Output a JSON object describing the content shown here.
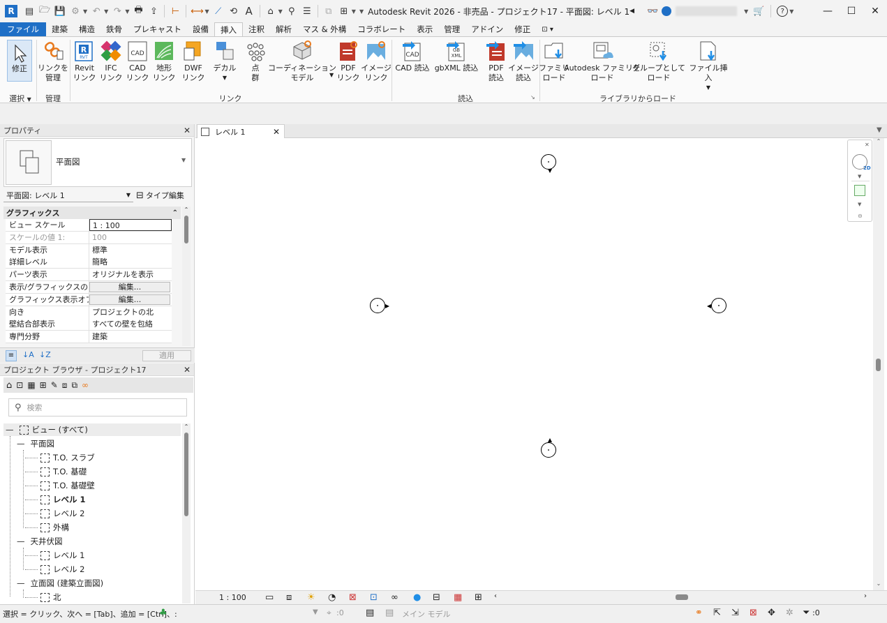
{
  "app": {
    "logo": "R",
    "title": "Autodesk Revit 2026 - 非売品 - プロジェクト17 - 平面図: レベル 1"
  },
  "tabs": [
    "ファイル",
    "建築",
    "構造",
    "鉄骨",
    "プレキャスト",
    "設備",
    "挿入",
    "注釈",
    "解析",
    "マス & 外構",
    "コラボレート",
    "表示",
    "管理",
    "アドイン",
    "修正"
  ],
  "active_tab": "挿入",
  "ribbon": {
    "modify": "修正",
    "manage_links": "リンクを\n管理",
    "revit_link": "Revit\nリンク",
    "ifc_link": "IFC\nリンク",
    "cad_link": "CAD\nリンク",
    "topo_link": "地形\nリンク",
    "dwf_link": "DWF\nリンク",
    "decal": "デカル",
    "point_cloud": "点\n群",
    "coord_model": "コーディネーション\nモデル",
    "pdf_link": "PDF\nリンク",
    "image_link": "イメージ\nリンク",
    "cad_import": "CAD 読込",
    "gbxml_import": "gbXML 読込",
    "pdf_import": "PDF\n読込",
    "image_import": "イメージ\n読込",
    "load_family": "ファミリ\nロード",
    "autodesk_family": "Autodesk ファミリを\nロード",
    "load_group": "グループとして\nロード",
    "insert_file": "ファイル挿入",
    "panel_select": "選択",
    "panel_manage": "管理",
    "panel_link": "リンク",
    "panel_import": "読込",
    "panel_library": "ライブラリからロード",
    "icon_labels": {
      "cad": "CAD",
      "gbxml": "GB\nXML",
      "rvt": "RVT"
    }
  },
  "properties": {
    "title": "プロパティ",
    "type_name": "平面図",
    "selector": "平面図: レベル 1",
    "edit_type": "タイプ編集",
    "section": "グラフィックス",
    "rows": [
      {
        "k": "ビュー スケール",
        "v": "1 : 100"
      },
      {
        "k": "スケールの値    1:",
        "v": "100"
      },
      {
        "k": "モデル表示",
        "v": "標準"
      },
      {
        "k": "詳細レベル",
        "v": "簡略"
      },
      {
        "k": "パーツ表示",
        "v": "オリジナルを表示"
      },
      {
        "k": "表示/グラフィックスの...",
        "v": "編集..."
      },
      {
        "k": "グラフィックス表示オプ...",
        "v": "編集..."
      },
      {
        "k": "向き",
        "v": "プロジェクトの北"
      },
      {
        "k": "壁結合部表示",
        "v": "すべての壁を包絡"
      },
      {
        "k": "専門分野",
        "v": "建築"
      }
    ],
    "apply": "適用"
  },
  "browser": {
    "title": "プロジェクト ブラウザ - プロジェクト17",
    "search_placeholder": "検索",
    "root": "ビュー (すべて)",
    "floor_plans": "平面図",
    "fp_items": [
      "T.O. スラブ",
      "T.O. 基礎",
      "T.O. 基礎壁",
      "レベル 1",
      "レベル 2",
      "外構"
    ],
    "ceiling": "天井伏図",
    "ceil_items": [
      "レベル 1",
      "レベル 2"
    ],
    "elevations": "立面図 (建築立面図)",
    "elev_items": [
      "北"
    ]
  },
  "view": {
    "tab": "レベル 1",
    "scale": "1 : 100"
  },
  "status": {
    "hint": "選択 = クリック、次へ = [Tab]、追加 = [Ctrl]、:",
    "coord": ":0",
    "model": "メイン モデル",
    "filter": ":0"
  }
}
